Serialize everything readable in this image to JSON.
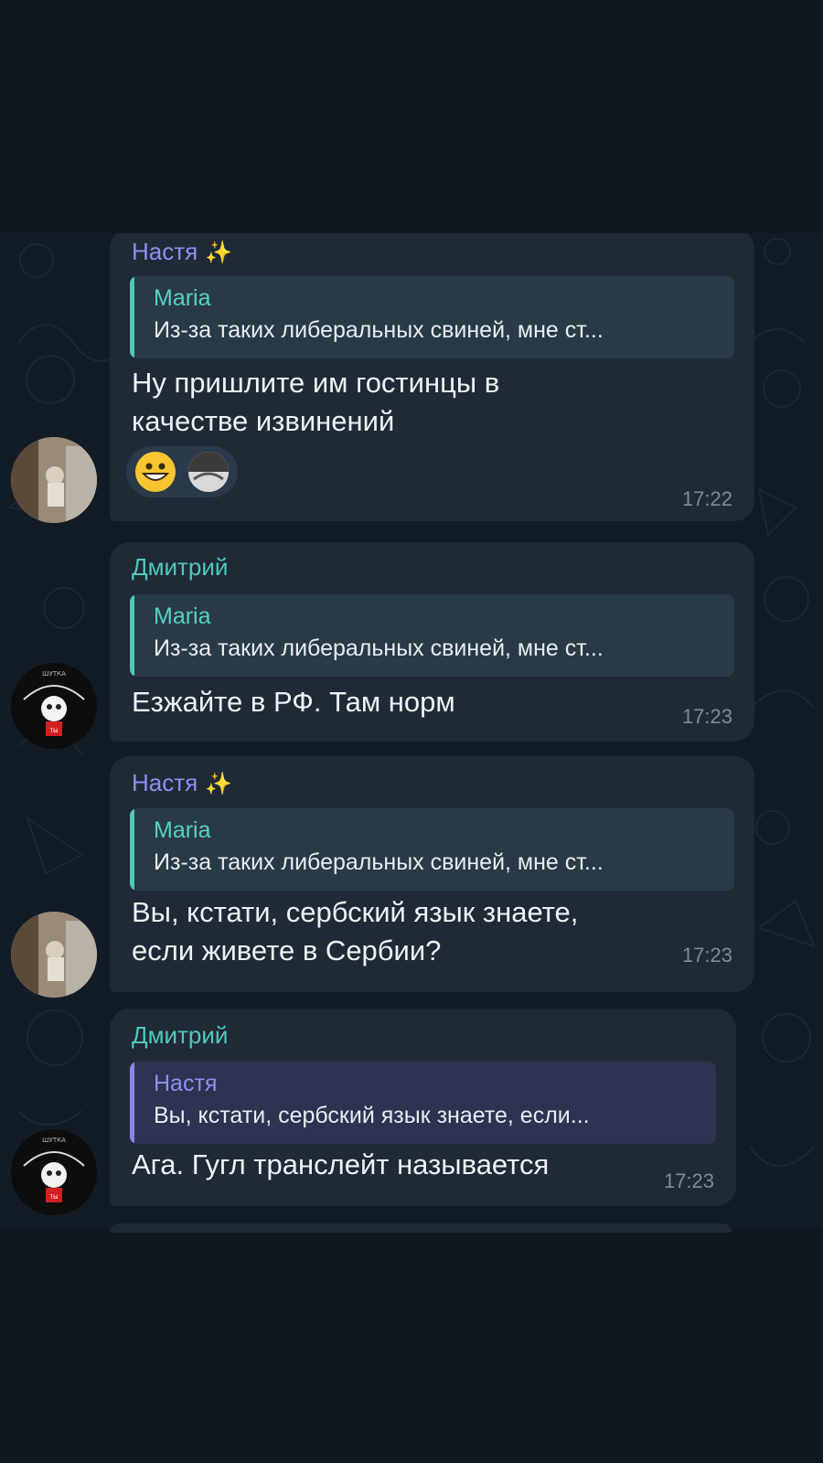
{
  "colors": {
    "background": "#111820",
    "chat_background": "#121c26",
    "bubble": "#1f2a36",
    "sender_nastya": "#8f8ff2",
    "sender_dmitry": "#4fc9bb",
    "text": "#eef2f6",
    "time": "#7e8d99"
  },
  "messages": [
    {
      "sender": "Настя",
      "sender_icon": "sparkles-icon",
      "reply": {
        "name": "Maria",
        "text": "Из-за таких либеральных свиней, мне ст..."
      },
      "text_lines": [
        "Ну пришлите им гостинцы в",
        "качестве извинений"
      ],
      "reactions": [
        "grinning-face-emoji",
        "user-avatar"
      ],
      "time": "17:22"
    },
    {
      "sender": "Дмитрий",
      "reply": {
        "name": "Maria",
        "text": "Из-за таких либеральных свиней, мне ст..."
      },
      "text_lines": [
        "Езжайте в РФ. Там норм"
      ],
      "time": "17:23"
    },
    {
      "sender": "Настя",
      "sender_icon": "sparkles-icon",
      "reply": {
        "name": "Maria",
        "text": "Из-за таких либеральных свиней, мне ст..."
      },
      "text_lines": [
        "Вы, кстати, сербский язык знаете,",
        "если живете в Сербии?"
      ],
      "time": "17:23"
    },
    {
      "sender": "Дмитрий",
      "reply": {
        "name": "Настя",
        "text": "Вы, кстати, сербский язык знаете, если..."
      },
      "text_lines": [
        "Ага. Гугл транслейт называется"
      ],
      "time": "17:23"
    }
  ]
}
